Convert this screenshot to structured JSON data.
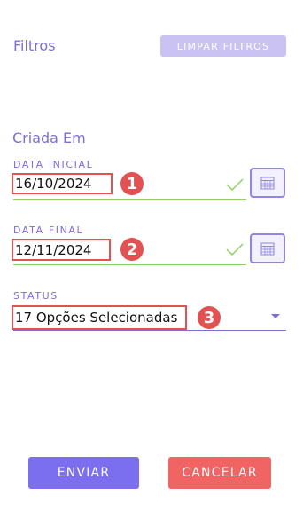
{
  "header": {
    "title": "Filtros",
    "clear_label": "LIMPAR FILTROS"
  },
  "section": {
    "label": "Criada Em"
  },
  "fields": {
    "start_date": {
      "label": "DATA INICIAL",
      "value": "16/10/2024",
      "badge": "1"
    },
    "end_date": {
      "label": "DATA FINAL",
      "value": "12/11/2024",
      "badge": "2"
    },
    "status": {
      "label": "STATUS",
      "value": "17 Opções Selecionadas",
      "badge": "3"
    }
  },
  "footer": {
    "submit_label": "ENVIAR",
    "cancel_label": "CANCELAR"
  },
  "colors": {
    "accent": "#7b6fd6",
    "success": "#8fcf64",
    "annotation": "#e25252",
    "cancel": "#f06464"
  }
}
